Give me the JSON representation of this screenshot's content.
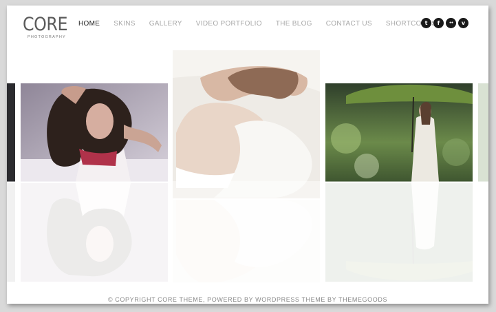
{
  "brand": {
    "name": "CORE",
    "tagline": "PHOTOGRAPHY"
  },
  "nav": {
    "items": [
      {
        "label": "HOME",
        "active": true
      },
      {
        "label": "SKINS",
        "active": false
      },
      {
        "label": "GALLERY",
        "active": false
      },
      {
        "label": "VIDEO PORTFOLIO",
        "active": false
      },
      {
        "label": "THE BLOG",
        "active": false
      },
      {
        "label": "CONTACT US",
        "active": false
      },
      {
        "label": "SHORTCODES",
        "active": false
      }
    ]
  },
  "social": [
    {
      "name": "twitter-icon",
      "glyph": "t"
    },
    {
      "name": "facebook-icon",
      "glyph": "f"
    },
    {
      "name": "flickr-icon",
      "glyph": "••"
    },
    {
      "name": "vimeo-icon",
      "glyph": "v"
    }
  ],
  "gallery": {
    "photos": [
      {
        "name": "photo-woman-curly-hair",
        "colors": [
          "#9a8fa0",
          "#e9e6ea",
          "#3a2a24"
        ]
      },
      {
        "name": "photo-woman-lying-white",
        "colors": [
          "#efeae4",
          "#d9c7b8",
          "#8d6a55"
        ]
      },
      {
        "name": "photo-woman-umbrella-forest",
        "colors": [
          "#3c5233",
          "#7f9a5c",
          "#d6d6c8"
        ]
      }
    ]
  },
  "footer": {
    "text": "© COPYRIGHT CORE THEME, POWERED BY WORDPRESS THEME BY THEMEGOODS"
  },
  "colors": {
    "accent": "#1a1a1a",
    "nav_inactive": "#a7a7a7",
    "nav_active": "#222222"
  }
}
